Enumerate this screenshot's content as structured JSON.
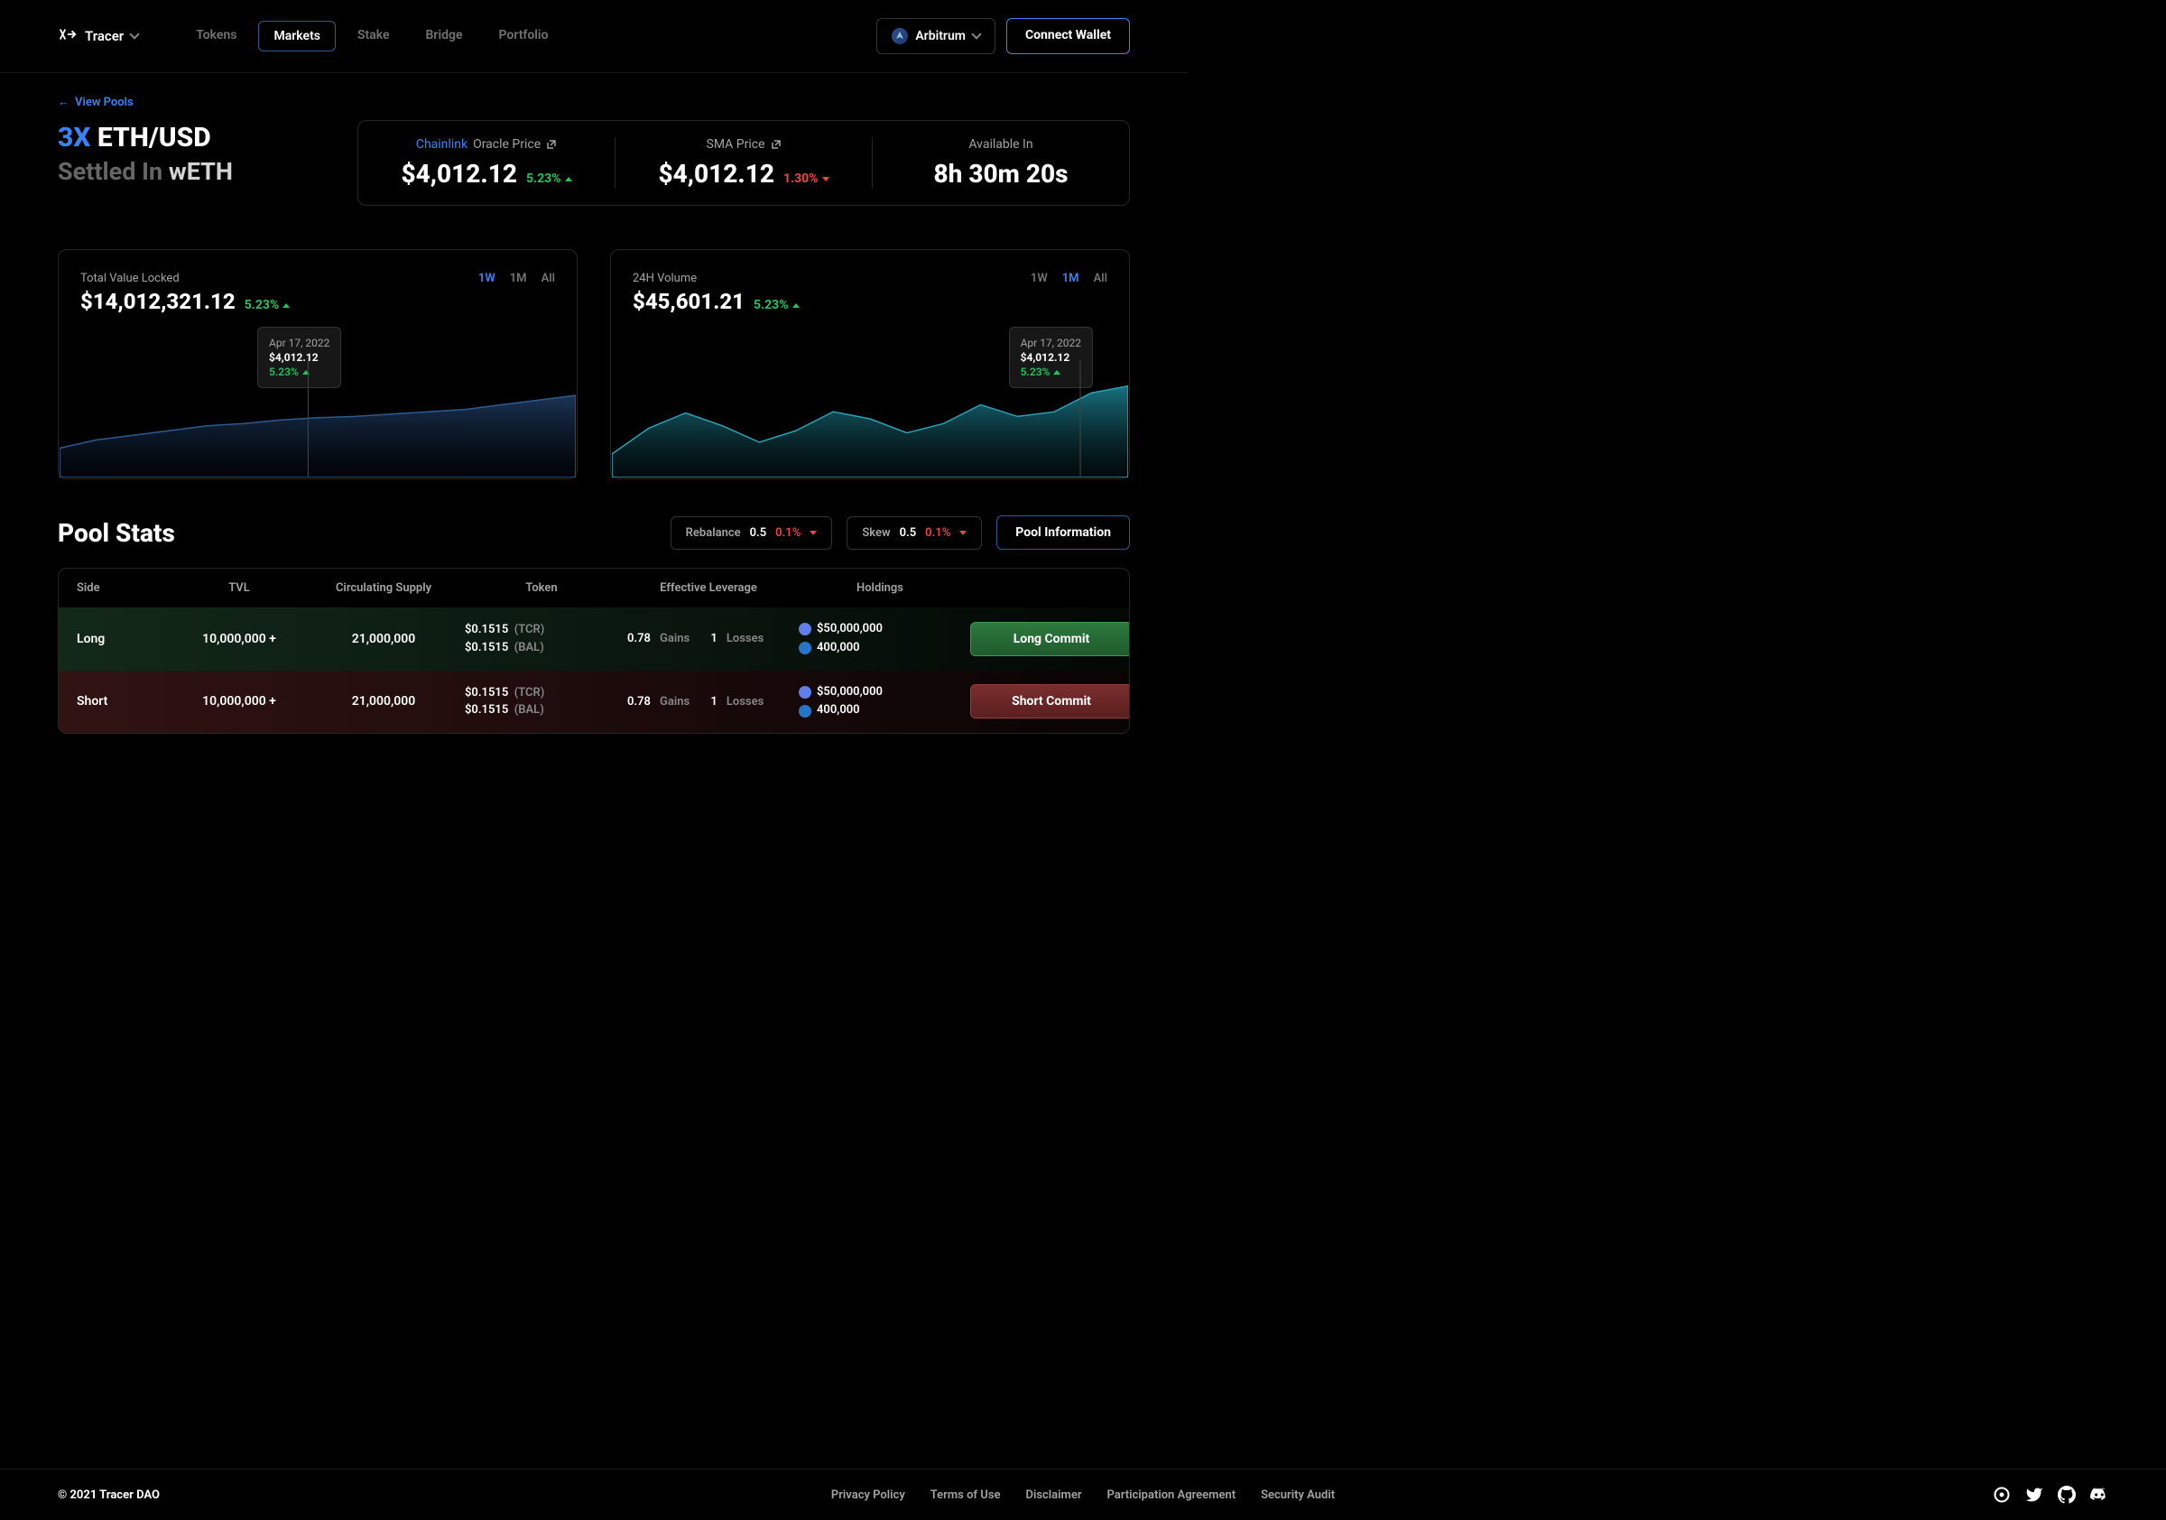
{
  "header": {
    "brand": "Tracer",
    "nav": [
      "Tokens",
      "Markets",
      "Stake",
      "Bridge",
      "Portfolio"
    ],
    "active_nav": "Markets",
    "network": "Arbitrum",
    "connect": "Connect Wallet"
  },
  "back_link": "View Pools",
  "hero": {
    "multiplier": "3X",
    "pair": "ETH/USD",
    "settled_label": "Settled In",
    "settled_asset": "wETH"
  },
  "stats": {
    "oracle": {
      "provider": "Chainlink",
      "label": "Oracle Price",
      "value": "$4,012.12",
      "pct": "5.23%",
      "dir": "up"
    },
    "sma": {
      "label": "SMA  Price",
      "value": "$4,012.12",
      "pct": "1.30%",
      "dir": "down"
    },
    "available": {
      "label": "Available In",
      "value": "8h 30m 20s"
    }
  },
  "charts": {
    "tvl": {
      "label": "Total Value Locked",
      "value": "$14,012,321.12",
      "pct": "5.23%",
      "dir": "up",
      "tabs": [
        "1W",
        "1M",
        "All"
      ],
      "active_tab": "1W",
      "tooltip": {
        "date": "Apr 17, 2022",
        "value": "$4,012.12",
        "pct": "5.23%"
      }
    },
    "volume": {
      "label": "24H Volume",
      "value": "$45,601.21",
      "pct": "5.23%",
      "dir": "up",
      "tabs": [
        "1W",
        "1M",
        "All"
      ],
      "active_tab": "1M",
      "tooltip": {
        "date": "Apr 17, 2022",
        "value": "$4,012.12",
        "pct": "5.23%"
      }
    }
  },
  "chart_data": [
    {
      "type": "area",
      "title": "Total Value Locked",
      "x": [
        0,
        1,
        2,
        3,
        4,
        5,
        6,
        7,
        8,
        9,
        10,
        11,
        12,
        13,
        14
      ],
      "values": [
        25,
        32,
        36,
        40,
        44,
        46,
        49,
        51,
        52,
        54,
        56,
        58,
        62,
        66,
        70
      ],
      "ylim": [
        0,
        100
      ]
    },
    {
      "type": "area",
      "title": "24H Volume",
      "x": [
        0,
        1,
        2,
        3,
        4,
        5,
        6,
        7,
        8,
        9,
        10,
        11,
        12,
        13,
        14
      ],
      "values": [
        20,
        42,
        55,
        44,
        30,
        40,
        56,
        50,
        38,
        46,
        62,
        52,
        56,
        72,
        78
      ],
      "ylim": [
        0,
        100
      ]
    }
  ],
  "pool": {
    "title": "Pool Stats",
    "rebalance": {
      "label": "Rebalance",
      "val": "0.5",
      "pct": "0.1%"
    },
    "skew": {
      "label": "Skew",
      "val": "0.5",
      "pct": "0.1%"
    },
    "info_btn": "Pool Information",
    "columns": [
      "Side",
      "TVL",
      "Circulating Supply",
      "Token",
      "Effective Leverage",
      "Holdings",
      ""
    ],
    "rows": [
      {
        "side": "Long",
        "tvl": "10,000,000 +",
        "supply": "21,000,000",
        "tokens": [
          {
            "price": "$0.1515",
            "sym": "(TCR)"
          },
          {
            "price": "$0.1515",
            "sym": "(BAL)"
          }
        ],
        "leverage": {
          "gains_val": "0.78",
          "gains_lbl": "Gains",
          "loss_val": "1",
          "loss_lbl": "Losses"
        },
        "holdings": [
          {
            "icon": "eth",
            "val": "$50,000,000"
          },
          {
            "icon": "usdc",
            "val": "400,000"
          }
        ],
        "btn": "Long Commit"
      },
      {
        "side": "Short",
        "tvl": "10,000,000 +",
        "supply": "21,000,000",
        "tokens": [
          {
            "price": "$0.1515",
            "sym": "(TCR)"
          },
          {
            "price": "$0.1515",
            "sym": "(BAL)"
          }
        ],
        "leverage": {
          "gains_val": "0.78",
          "gains_lbl": "Gains",
          "loss_val": "1",
          "loss_lbl": "Losses"
        },
        "holdings": [
          {
            "icon": "eth",
            "val": "$50,000,000"
          },
          {
            "icon": "usdc",
            "val": "400,000"
          }
        ],
        "btn": "Short Commit"
      }
    ]
  },
  "footer": {
    "copy": "© 2021 Tracer DAO",
    "links": [
      "Privacy Policy",
      "Terms of Use",
      "Disclaimer",
      "Participation Agreement",
      "Security Audit"
    ]
  }
}
